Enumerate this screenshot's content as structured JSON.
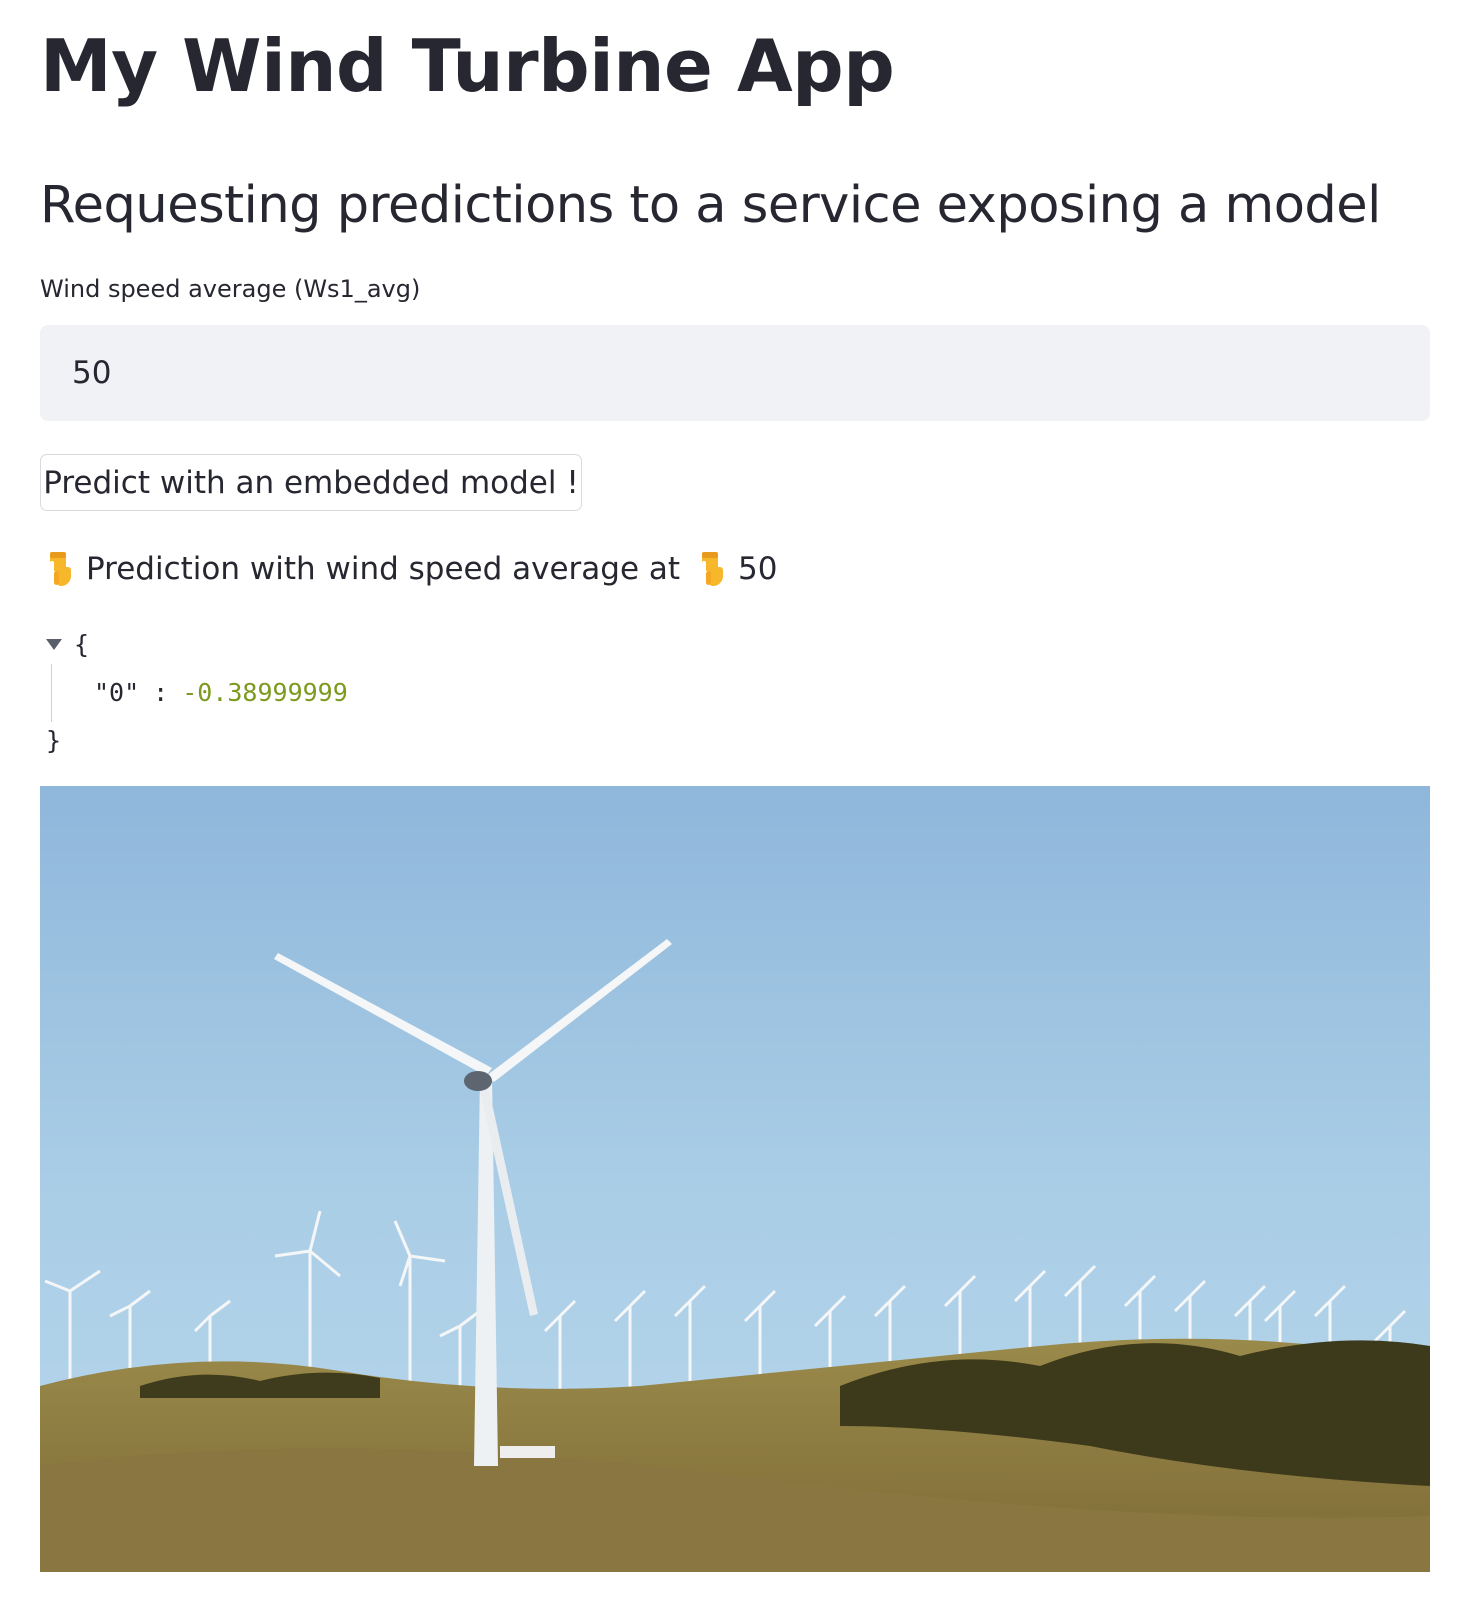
{
  "app": {
    "title": "My Wind Turbine App",
    "subtitle": "Requesting predictions to a service exposing a model"
  },
  "input": {
    "label": "Wind speed average (Ws1_avg)",
    "value": "50"
  },
  "predict_button": {
    "label": "Predict with an embedded model !"
  },
  "result": {
    "prefix": "Prediction with wind speed average at",
    "value": "50",
    "icon": "pointing-down-hand-icon"
  },
  "json_output": {
    "open_brace": "{",
    "close_brace": "}",
    "key": "\"0\"",
    "colon": ":",
    "value": "-0.38999999"
  },
  "colors": {
    "background": "#ffffff",
    "text": "#262730",
    "input_bg": "#f0f2f6",
    "json_number": "#7c9a1e",
    "sky": "#a6cbe3"
  }
}
